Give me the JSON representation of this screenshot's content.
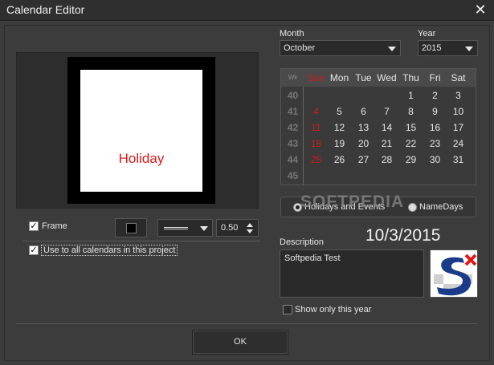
{
  "window": {
    "title": "Calendar Editor",
    "close_glyph": "✕"
  },
  "preview": {
    "page_text": "Holiday",
    "accent_color": "#e01a1a"
  },
  "frame": {
    "checked": true,
    "label": "Frame",
    "color": "#000000",
    "line_style": "double",
    "width_value": "0.50"
  },
  "use_all": {
    "checked": true,
    "label": "Use to  all calendars in this project"
  },
  "month": {
    "label": "Month",
    "value": "October"
  },
  "year": {
    "label": "Year",
    "value": "2015"
  },
  "calendar": {
    "week_header": "Wk",
    "weekdays": [
      "Sun",
      "Mon",
      "Tue",
      "Wed",
      "Thu",
      "Fri",
      "Sat"
    ],
    "weeks": [
      {
        "week": "40",
        "days": [
          "",
          "",
          "",
          "",
          "1",
          "2",
          "3"
        ]
      },
      {
        "week": "41",
        "days": [
          "4",
          "5",
          "6",
          "7",
          "8",
          "9",
          "10"
        ]
      },
      {
        "week": "42",
        "days": [
          "11",
          "12",
          "13",
          "14",
          "15",
          "16",
          "17"
        ]
      },
      {
        "week": "43",
        "days": [
          "18",
          "19",
          "20",
          "21",
          "22",
          "23",
          "24"
        ]
      },
      {
        "week": "44",
        "days": [
          "25",
          "26",
          "27",
          "28",
          "29",
          "30",
          "31"
        ]
      },
      {
        "week": "45",
        "days": [
          "",
          "",
          "",
          "",
          "",
          "",
          ""
        ]
      }
    ],
    "sunday_color": "#d01a1a"
  },
  "watermark": "SOFTPEDIA",
  "mode": {
    "options": [
      "Holidays and Events",
      "NameDays"
    ],
    "selected": "Holidays and Events"
  },
  "description": {
    "label": "Description",
    "value": "Softpedia Test"
  },
  "selected_date": "10/3/2015",
  "show_only_year": {
    "checked": false,
    "label": "Show only this year"
  },
  "ok_label": "OK"
}
